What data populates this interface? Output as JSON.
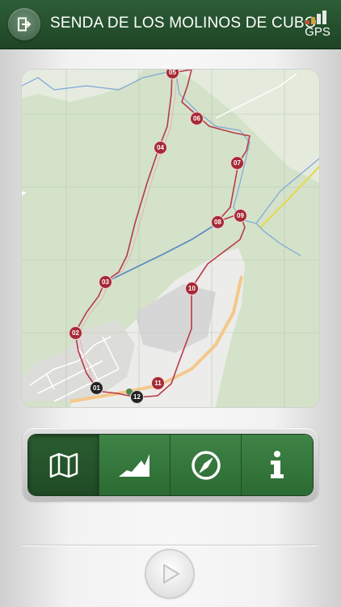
{
  "header": {
    "title": "SENDA DE LOS MOLINOS DE CUBO",
    "gps_label": "GPS"
  },
  "map": {
    "waypoints": [
      {
        "label": "05",
        "style": "red"
      },
      {
        "label": "06",
        "style": "red"
      },
      {
        "label": "04",
        "style": "red"
      },
      {
        "label": "07",
        "style": "red"
      },
      {
        "label": "08",
        "style": "red"
      },
      {
        "label": "09",
        "style": "red"
      },
      {
        "label": "03",
        "style": "red"
      },
      {
        "label": "10",
        "style": "red"
      },
      {
        "label": "02",
        "style": "red"
      },
      {
        "label": "11",
        "style": "red"
      },
      {
        "label": "01",
        "style": "dark"
      },
      {
        "label": "12",
        "style": "dark"
      }
    ],
    "route_color": "#b93a4a",
    "river_color": "#5d86c4"
  },
  "toolbar": {
    "items": [
      {
        "name": "map-icon",
        "active": true
      },
      {
        "name": "elevation-profile-icon",
        "active": false
      },
      {
        "name": "compass-icon",
        "active": false
      },
      {
        "name": "info-icon",
        "active": false
      }
    ]
  },
  "colors": {
    "header": "#245030",
    "toolbar_green": "#347a3c",
    "waypoint_red": "#a52a36"
  }
}
